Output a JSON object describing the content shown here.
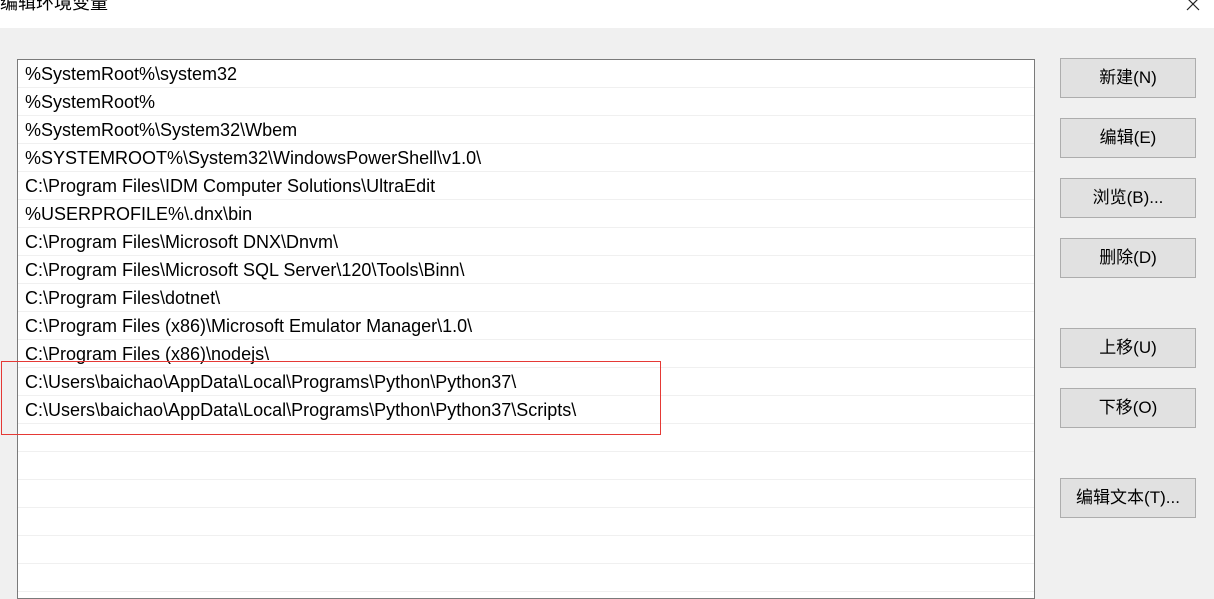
{
  "window": {
    "title": "编辑环境变量",
    "close_icon": "close-icon"
  },
  "path_list": {
    "items": [
      "%SystemRoot%\\system32",
      "%SystemRoot%",
      "%SystemRoot%\\System32\\Wbem",
      "%SYSTEMROOT%\\System32\\WindowsPowerShell\\v1.0\\",
      "C:\\Program Files\\IDM Computer Solutions\\UltraEdit",
      "%USERPROFILE%\\.dnx\\bin",
      "C:\\Program Files\\Microsoft DNX\\Dnvm\\",
      "C:\\Program Files\\Microsoft SQL Server\\120\\Tools\\Binn\\",
      "C:\\Program Files\\dotnet\\",
      "C:\\Program Files (x86)\\Microsoft Emulator Manager\\1.0\\",
      "C:\\Program Files (x86)\\nodejs\\",
      "C:\\Users\\baichao\\AppData\\Local\\Programs\\Python\\Python37\\",
      "C:\\Users\\baichao\\AppData\\Local\\Programs\\Python\\Python37\\Scripts\\",
      "",
      "",
      "",
      "",
      "",
      ""
    ],
    "highlight_color": "#e53935"
  },
  "buttons": {
    "new": "新建(N)",
    "edit": "编辑(E)",
    "browse": "浏览(B)...",
    "delete": "删除(D)",
    "move_up": "上移(U)",
    "move_down": "下移(O)",
    "edit_text": "编辑文本(T)..."
  }
}
